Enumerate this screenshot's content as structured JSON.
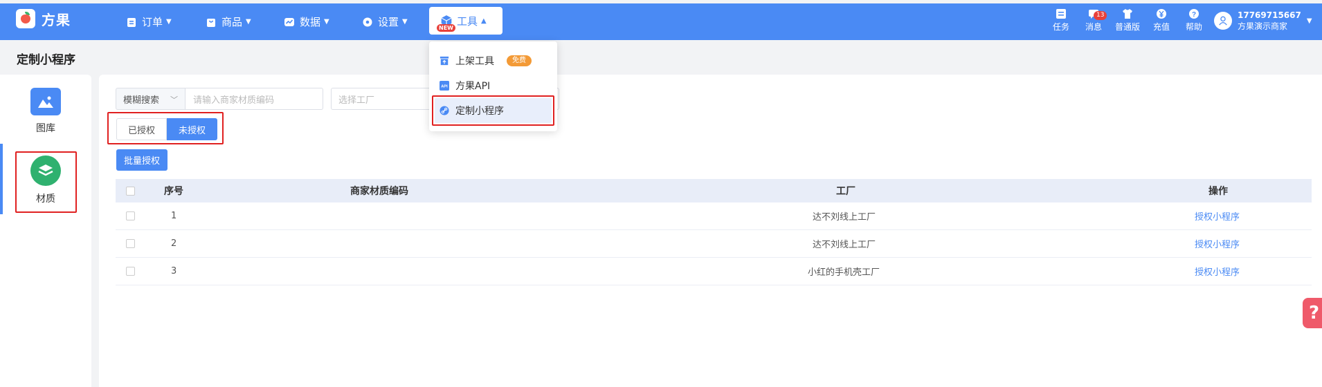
{
  "brand": {
    "name": "方果"
  },
  "nav": [
    {
      "label": "订单",
      "icon": "clipboard-icon"
    },
    {
      "label": "商品",
      "icon": "bag-icon"
    },
    {
      "label": "数据",
      "icon": "chart-icon"
    },
    {
      "label": "设置",
      "icon": "gear-icon"
    }
  ],
  "tools_menu": {
    "label": "工具",
    "badge": "NEW"
  },
  "dropdown": {
    "items": [
      {
        "label": "上架工具",
        "tag": "免费",
        "icon": "upload-box-icon"
      },
      {
        "label": "方果API",
        "icon": "api-icon"
      },
      {
        "label": "定制小程序",
        "icon": "link-icon"
      }
    ]
  },
  "toolbar_right": {
    "tasks": "任务",
    "messages": "消息",
    "message_count": "13",
    "edition": "普通版",
    "recharge": "充值",
    "help": "帮助"
  },
  "user": {
    "phone": "17769715667",
    "name": "方果演示商家"
  },
  "page_title": "定制小程序",
  "left_panel": {
    "items": [
      {
        "label": "图库",
        "icon": "image-icon",
        "color": "#4a8af4"
      },
      {
        "label": "材质",
        "icon": "layers-icon",
        "color": "#2fb16f"
      }
    ]
  },
  "filters": {
    "search_mode": "模糊搜索",
    "search_placeholder": "请输入商家材质编码",
    "factory_placeholder": "选择工厂"
  },
  "tabs": {
    "authorized": "已授权",
    "unauthorized": "未授权"
  },
  "batch_button": "批量授权",
  "table": {
    "headers": {
      "index": "序号",
      "code": "商家材质编码",
      "factory": "工厂",
      "action": "操作"
    },
    "rows": [
      {
        "index": "1",
        "code": "",
        "factory": "达不刘线上工厂",
        "action": "授权小程序"
      },
      {
        "index": "2",
        "code": "",
        "factory": "达不刘线上工厂",
        "action": "授权小程序"
      },
      {
        "index": "3",
        "code": "",
        "factory": "小红的手机壳工厂",
        "action": "授权小程序"
      }
    ]
  },
  "colors": {
    "primary": "#4a8af4",
    "highlight_border": "#e02020",
    "tag_orange": "#f39a36"
  }
}
